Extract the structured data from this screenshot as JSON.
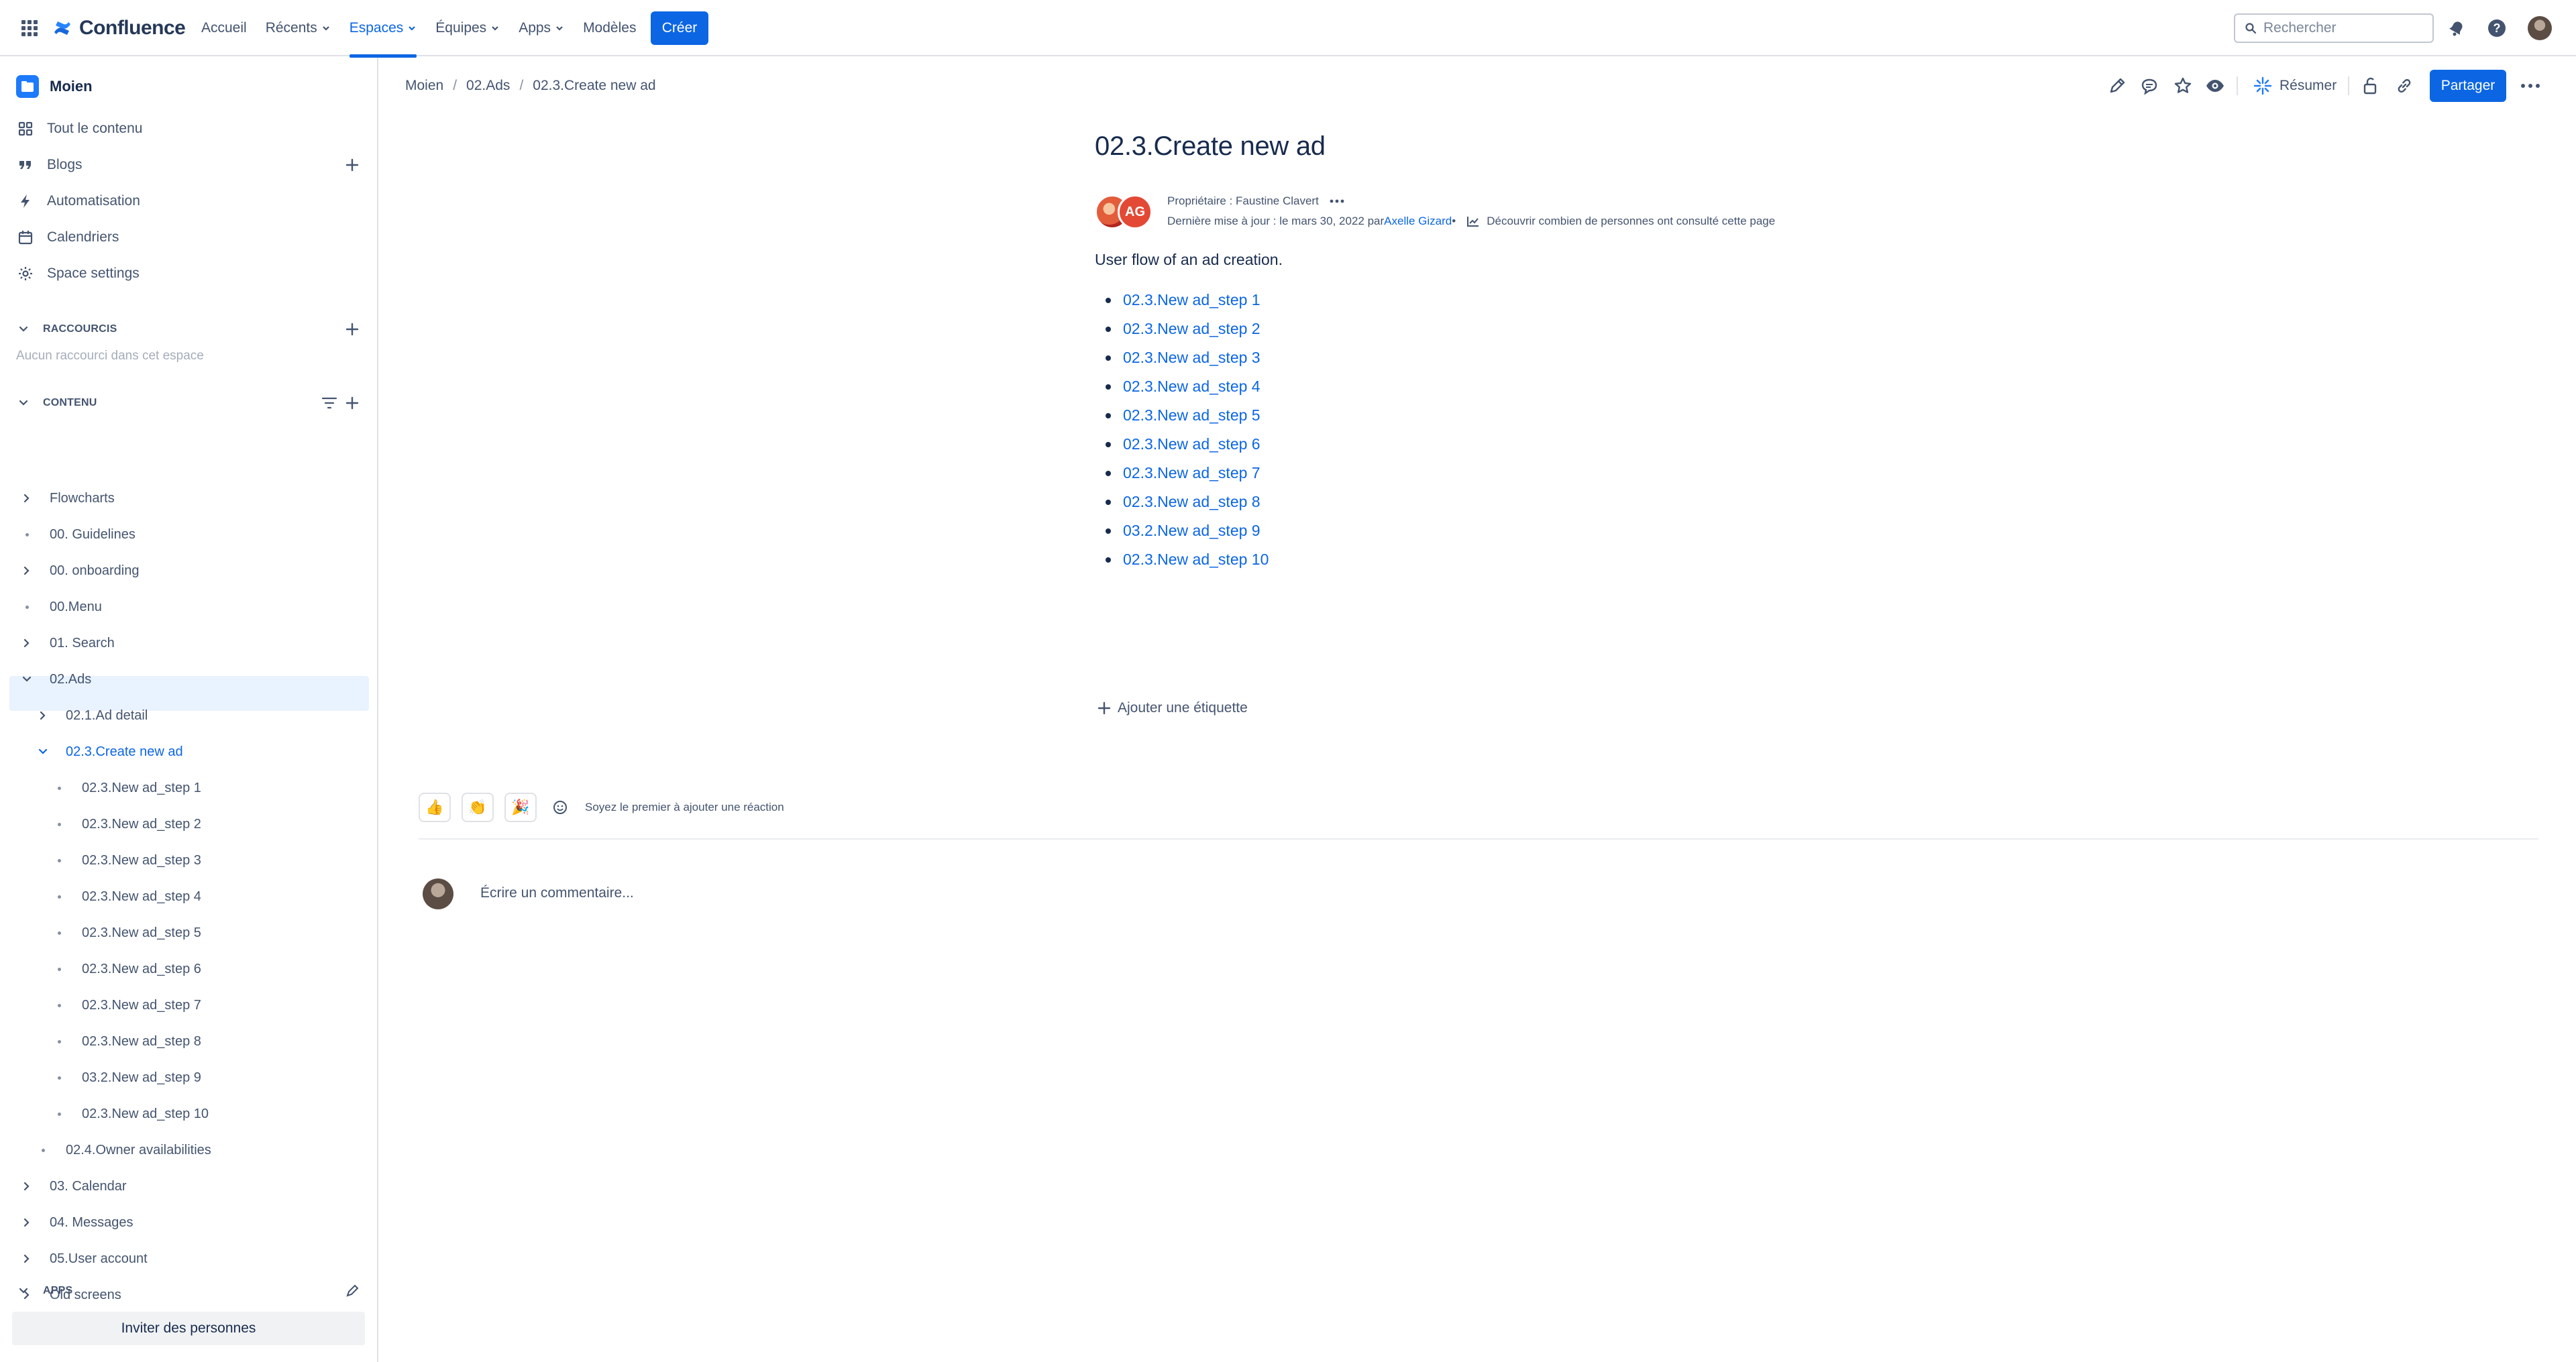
{
  "topbar": {
    "app_name": "Confluence",
    "nav": [
      {
        "label": "Accueil",
        "dropdown": false
      },
      {
        "label": "Récents",
        "dropdown": true
      },
      {
        "label": "Espaces",
        "dropdown": true,
        "active": true
      },
      {
        "label": "Équipes",
        "dropdown": true
      },
      {
        "label": "Apps",
        "dropdown": true
      },
      {
        "label": "Modèles",
        "dropdown": false
      }
    ],
    "create_label": "Créer",
    "search_placeholder": "Rechercher",
    "brand_color": "#0c66e4"
  },
  "sidebar": {
    "space_name": "Moien",
    "links": [
      {
        "label": "Tout le contenu",
        "icon": "all-content-icon"
      },
      {
        "label": "Blogs",
        "icon": "quote-icon"
      },
      {
        "label": "Automatisation",
        "icon": "lightning-icon"
      },
      {
        "label": "Calendriers",
        "icon": "calendar-icon"
      },
      {
        "label": "Space settings",
        "icon": "gear-icon"
      }
    ],
    "shortcuts_title": "RACCOURCIS",
    "shortcuts_empty": "Aucun raccourci dans cet espace",
    "content_title": "CONTENU",
    "tree": [
      {
        "label": "Flowcharts",
        "level": 0,
        "type": "chevron-right"
      },
      {
        "label": "00. Guidelines",
        "level": 0,
        "type": "dot"
      },
      {
        "label": "00. onboarding",
        "level": 0,
        "type": "chevron-right"
      },
      {
        "label": "00.Menu",
        "level": 0,
        "type": "dot"
      },
      {
        "label": "01. Search",
        "level": 0,
        "type": "chevron-right"
      },
      {
        "label": "02.Ads",
        "level": 0,
        "type": "chevron-down"
      },
      {
        "label": "02.1.Ad detail",
        "level": 1,
        "type": "chevron-right"
      },
      {
        "label": "02.3.Create new ad",
        "level": 1,
        "type": "chevron-down",
        "selected": true
      },
      {
        "label": "02.3.New ad_step 1",
        "level": 2,
        "type": "dot"
      },
      {
        "label": "02.3.New ad_step 2",
        "level": 2,
        "type": "dot"
      },
      {
        "label": "02.3.New ad_step 3",
        "level": 2,
        "type": "dot"
      },
      {
        "label": "02.3.New ad_step 4",
        "level": 2,
        "type": "dot"
      },
      {
        "label": "02.3.New ad_step 5",
        "level": 2,
        "type": "dot"
      },
      {
        "label": "02.3.New ad_step 6",
        "level": 2,
        "type": "dot"
      },
      {
        "label": "02.3.New ad_step 7",
        "level": 2,
        "type": "dot"
      },
      {
        "label": "02.3.New ad_step 8",
        "level": 2,
        "type": "dot"
      },
      {
        "label": "03.2.New ad_step 9",
        "level": 2,
        "type": "dot"
      },
      {
        "label": "02.3.New ad_step 10",
        "level": 2,
        "type": "dot"
      },
      {
        "label": "02.4.Owner availabilities",
        "level": 1,
        "type": "dot"
      },
      {
        "label": "03. Calendar",
        "level": 0,
        "type": "chevron-right"
      },
      {
        "label": "04. Messages",
        "level": 0,
        "type": "chevron-right"
      },
      {
        "label": "05.User account",
        "level": 0,
        "type": "chevron-right"
      },
      {
        "label": "Old screens",
        "level": 0,
        "type": "chevron-right"
      }
    ],
    "apps_title": "APPS",
    "invite_label": "Inviter des personnes"
  },
  "breadcrumb": [
    "Moien",
    "02.Ads",
    "02.3.Create new ad"
  ],
  "actions": {
    "summarize_label": "Résumer",
    "share_label": "Partager"
  },
  "page": {
    "title": "02.3.Create new ad",
    "owner_text": "Propriétaire : Faustine Clavert",
    "updated_text": "Dernière mise à jour : le mars 30, 2022 par ",
    "updated_author": "Axelle Gizard",
    "updated_sep": "•",
    "views_text": "Découvrir combien de personnes ont consulté cette page",
    "avatar_initials": "AG",
    "intro": "User flow of an ad creation.",
    "steps": [
      "02.3.New ad_step 1",
      "02.3.New ad_step 2",
      "02.3.New ad_step 3",
      "02.3.New ad_step 4",
      "02.3.New ad_step 5",
      "02.3.New ad_step 6",
      "02.3.New ad_step 7",
      "02.3.New ad_step 8",
      "03.2.New ad_step 9",
      "02.3.New ad_step 10"
    ],
    "add_label": "Ajouter une étiquette",
    "reactions": [
      "👍",
      "👏",
      "🎉"
    ],
    "reaction_note": "Soyez le premier à ajouter une réaction",
    "comment_placeholder": "Écrire un commentaire..."
  }
}
